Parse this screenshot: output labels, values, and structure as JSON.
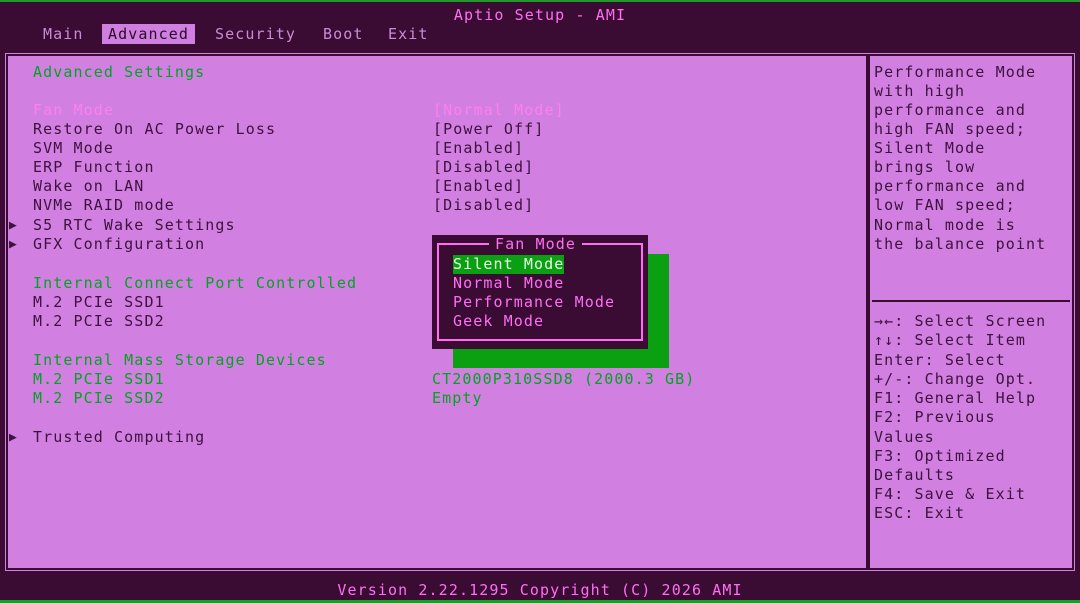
{
  "header": {
    "title": "Aptio Setup - AMI"
  },
  "tabs": [
    "Main",
    "Advanced",
    "Security",
    "Boot",
    "Exit"
  ],
  "section_title": "Advanced Settings",
  "settings": [
    {
      "label": "Fan Mode",
      "value": "[Normal Mode]"
    },
    {
      "label": "Restore On AC Power Loss",
      "value": "[Power Off]"
    },
    {
      "label": "SVM Mode",
      "value": "[Enabled]"
    },
    {
      "label": "ERP Function",
      "value": "[Disabled]"
    },
    {
      "label": "Wake on LAN",
      "value": "[Enabled]"
    },
    {
      "label": "NVMe RAID mode",
      "value": "[Disabled]"
    }
  ],
  "submenus": [
    "S5 RTC Wake Settings",
    "GFX Configuration",
    "Trusted Computing"
  ],
  "internal_connect": {
    "title": "Internal Connect Port Controlled",
    "items": [
      "M.2 PCIe SSD1",
      "M.2 PCIe SSD2"
    ]
  },
  "mass_storage": {
    "title": "Internal Mass Storage Devices",
    "items": [
      {
        "label": "M.2 PCIe SSD1",
        "value": "CT2000P310SSD8 (2000.3 GB)"
      },
      {
        "label": "M.2 PCIe SSD2",
        "value": "Empty"
      }
    ]
  },
  "popup": {
    "title": "Fan Mode",
    "options": [
      "Silent Mode",
      "Normal Mode",
      "Performance Mode",
      "Geek Mode"
    ],
    "selected_index": 0
  },
  "help": {
    "description": [
      "Performance Mode",
      "with high",
      "performance and",
      "high FAN speed;",
      "Silent Mode",
      "brings low",
      "performance and",
      "low FAN speed;",
      "Normal mode is",
      "the balance point"
    ],
    "keys": [
      "→←: Select Screen",
      "↑↓: Select Item",
      "Enter: Select",
      "+/-: Change Opt.",
      "F1: General Help",
      "F2: Previous",
      "Values",
      "F3: Optimized",
      "Defaults",
      "F4: Save & Exit",
      "ESC: Exit"
    ]
  },
  "footer": {
    "version": "Version 2.22.1295 Copyright (C) 2026 AMI"
  },
  "colors": {
    "accent_pink": "#ff6ef2",
    "accent_green": "#00a51f",
    "background": "#d27fe2",
    "bar": "#3a0c33"
  },
  "icons": {
    "submenu": "triangle-right-icon"
  }
}
